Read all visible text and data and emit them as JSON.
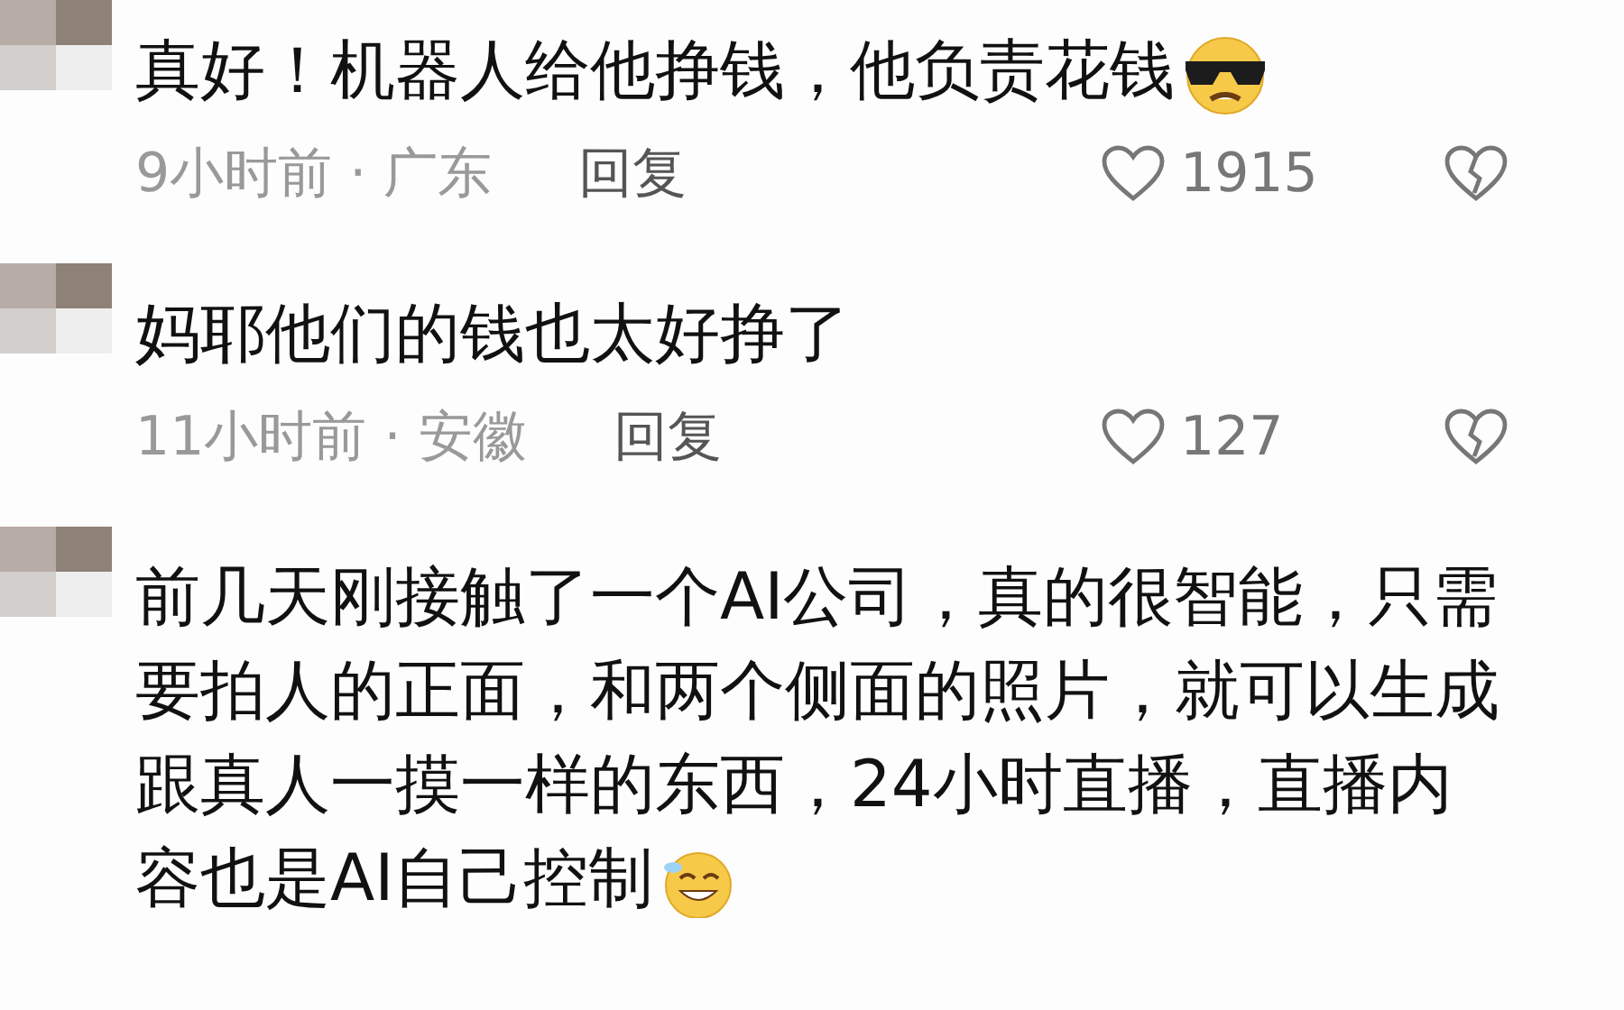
{
  "comments": [
    {
      "text": "真好！机器人给他挣钱，他负责花钱",
      "kind": "sunglasses",
      "meta": "9小时前 · 广东",
      "reply": "回复",
      "likes": "1915"
    },
    {
      "text": "妈耶他们的钱也太好挣了",
      "kind": "plain",
      "meta": "11小时前 · 安徽",
      "reply": "回复",
      "likes": "127"
    },
    {
      "text": "前几天刚接触了一个AI公司，真的很智能，只需要拍人的正面，和两个侧面的照片，就可以生成跟真人一摸一样的东西，24小时直播，直播内容也是AI自己控制",
      "kind": "grin"
    }
  ]
}
